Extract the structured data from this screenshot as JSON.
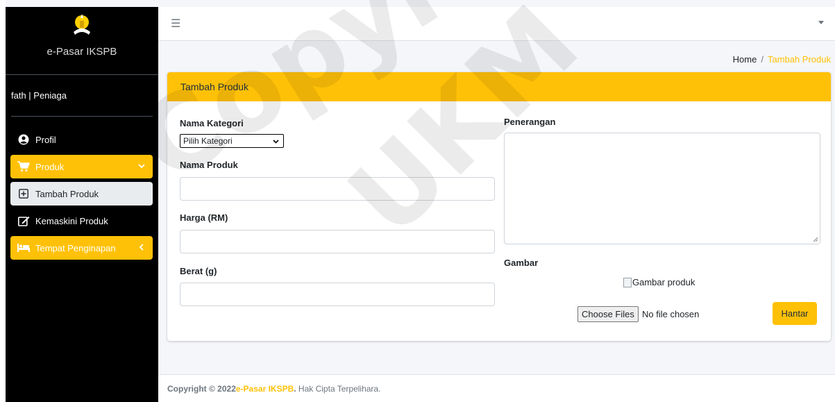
{
  "sidebar": {
    "brand_text": "e-Pasar IKSPB",
    "user_label": "fath | Peniaga",
    "items": [
      {
        "label": "Profil",
        "icon": "user-circle-icon"
      },
      {
        "label": "Produk",
        "icon": "cart-icon",
        "active": true
      },
      {
        "label": "Tambah Produk",
        "icon": "plus-square-icon"
      },
      {
        "label": "Kemaskini Produk",
        "icon": "edit-icon"
      },
      {
        "label": "Tempat Penginapan",
        "icon": "bed-icon",
        "active": true
      }
    ]
  },
  "topbar": {
    "menu_icon": "hamburger-icon",
    "dropdown_icon": "caret-down-icon"
  },
  "breadcrumb": {
    "home": "Home",
    "separator": "/",
    "current": "Tambah Produk"
  },
  "card": {
    "title": "Tambah Produk",
    "fields": {
      "kategori_label": "Nama Kategori",
      "kategori_selected": "Pilih Kategori",
      "nama_label": "Nama Produk",
      "nama_value": "",
      "harga_label": "Harga (RM)",
      "harga_value": "",
      "berat_label": "Berat (g)",
      "berat_value": "",
      "penerangan_label": "Penerangan",
      "penerangan_value": "",
      "gambar_label": "Gambar",
      "gambar_alt": "Gambar produk",
      "file_button": "Choose Files",
      "file_status": "No file chosen"
    },
    "submit_label": "Hantar"
  },
  "footer": {
    "prefix": "Copyright © 2022 ",
    "brand": "e-Pasar IKSPB",
    "suffix": ". Hak Cipta Terpelihara."
  },
  "watermark": {
    "line1": "Copyright",
    "line2": "UKM"
  },
  "colors": {
    "accent": "#ffc107",
    "sidebar_bg": "#000000",
    "page_bg": "#f4f6f9"
  }
}
